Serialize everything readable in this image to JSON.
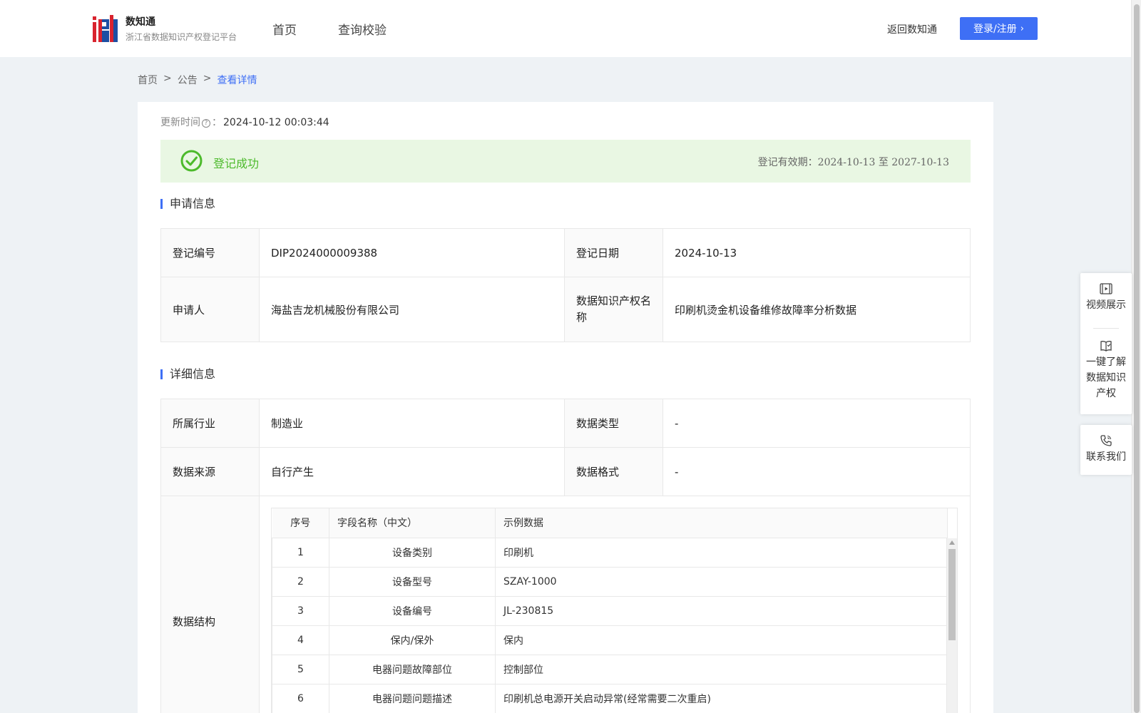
{
  "header": {
    "brand_name": "数知通",
    "brand_subtitle": "浙江省数据知识产权登记平台",
    "nav": [
      "首页",
      "查询校验"
    ],
    "back_link": "返回数知通",
    "login_button": "登录/注册"
  },
  "breadcrumb": {
    "items": [
      "首页",
      "公告",
      "查看详情"
    ],
    "separator": ">"
  },
  "update": {
    "label": "更新时间",
    "suffix": "：",
    "value": "2024-10-12 00:03:44"
  },
  "status": {
    "text": "登记成功",
    "validity_label": "登记有效期：",
    "validity_dates": "2024-10-13 至 2027-10-13"
  },
  "sections": {
    "application": "申请信息",
    "detail": "详细信息"
  },
  "application": {
    "reg_no_label": "登记编号",
    "reg_no": "DIP2024000009388",
    "reg_date_label": "登记日期",
    "reg_date": "2024-10-13",
    "applicant_label": "申请人",
    "applicant": "海盐吉龙机械股份有限公司",
    "ip_name_label": "数据知识产权名称",
    "ip_name": "印刷机烫金机设备维修故障率分析数据"
  },
  "detail": {
    "industry_label": "所属行业",
    "industry": "制造业",
    "data_type_label": "数据类型",
    "data_type": "-",
    "source_label": "数据来源",
    "source": "自行产生",
    "format_label": "数据格式",
    "format": "-",
    "structure_label": "数据结构"
  },
  "structure": {
    "columns": [
      "序号",
      "字段名称（中文）",
      "示例数据"
    ],
    "rows": [
      [
        "1",
        "设备类别",
        "印刷机"
      ],
      [
        "2",
        "设备型号",
        "SZAY-1000"
      ],
      [
        "3",
        "设备编号",
        "JL-230815"
      ],
      [
        "4",
        "保内/保外",
        "保内"
      ],
      [
        "5",
        "电器问题故障部位",
        "控制部位"
      ],
      [
        "6",
        "电器问题问题描述",
        "印刷机总电源开关启动异常(经常需要二次重启)"
      ]
    ]
  },
  "side_panel": {
    "video": "视频展示",
    "learn": "一键了解数据知识产权",
    "contact": "联系我们"
  },
  "colors": {
    "accent": "#3e6ff5",
    "success": "#4cba2b",
    "success_bg": "#e9f7e3",
    "logo_red": "#d9232e",
    "logo_blue": "#1d4fa3"
  },
  "icons": [
    "logo-icon",
    "help-circle-icon",
    "check-circle-icon",
    "chevron-right-icon",
    "video-icon",
    "book-icon",
    "phone-icon"
  ]
}
